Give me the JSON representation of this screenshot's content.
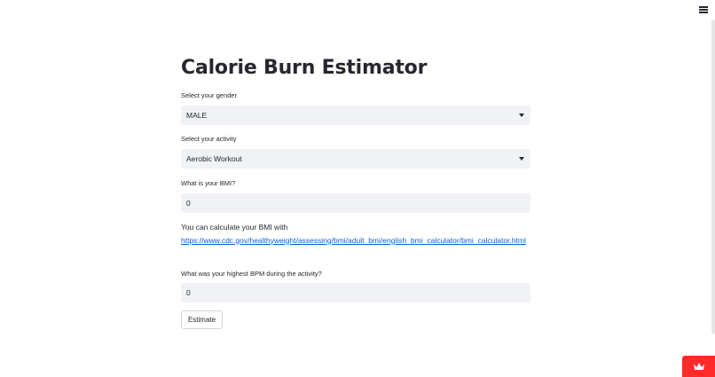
{
  "app": {
    "title": "Calorie Burn Estimator"
  },
  "header": {
    "menu_icon": "hamburger-menu-icon"
  },
  "form": {
    "gender": {
      "label": "Select your gender",
      "value": "MALE"
    },
    "activity": {
      "label": "Select your activity",
      "value": "Aerobic Workout"
    },
    "bmi": {
      "label": "What is your BMI?",
      "value": "0"
    },
    "bmi_info": {
      "text": "You can calculate your BMI with",
      "link": "https://www.cdc.gov/healthyweight/assessing/bmi/adult_bmi/english_bmi_calculator/bmi_calculator.html"
    },
    "bpm": {
      "label": "What was your highest BPM during the activity?",
      "value": "0"
    },
    "estimate_button": "Estimate"
  },
  "badge": {
    "icon": "crown-icon",
    "color": "#ff2b2b"
  }
}
